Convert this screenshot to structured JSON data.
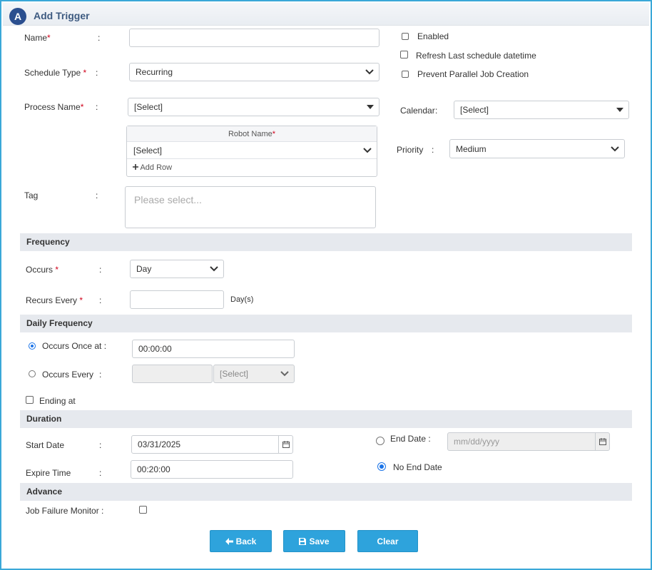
{
  "header": {
    "logo_letter": "A",
    "title": "Add Trigger"
  },
  "form": {
    "name": {
      "label": "Name",
      "value": ""
    },
    "schedule_type": {
      "label": "Schedule Type",
      "value": "Recurring"
    },
    "process_name": {
      "label": "Process Name",
      "value": "[Select]"
    },
    "robot": {
      "header": "Robot Name",
      "value": "[Select]",
      "add_row": "Add Row"
    },
    "tag": {
      "label": "Tag",
      "placeholder": "Please select..."
    },
    "options": {
      "enabled": "Enabled",
      "refresh": "Refresh Last schedule datetime",
      "prevent_parallel": "Prevent Parallel Job Creation"
    },
    "calendar": {
      "label": "Calendar",
      "value": "[Select]"
    },
    "priority": {
      "label": "Priority",
      "value": "Medium"
    },
    "colon": ":",
    "required_mark": "*"
  },
  "frequency": {
    "heading": "Frequency",
    "occurs": {
      "label": "Occurs",
      "value": "Day"
    },
    "recurs_every": {
      "label": "Recurs Every",
      "value": "",
      "unit": "Day(s)"
    }
  },
  "daily_frequency": {
    "heading": "Daily Frequency",
    "once": {
      "label": "Occurs Once at :",
      "value": "00:00:00"
    },
    "every": {
      "label": "Occurs Every",
      "value": "",
      "unit": "[Select]"
    },
    "ending_at": "Ending at"
  },
  "duration": {
    "heading": "Duration",
    "start_date": {
      "label": "Start Date",
      "value": "03/31/2025"
    },
    "expire_time": {
      "label": "Expire Time",
      "value": "00:20:00"
    },
    "end_date": {
      "label": "End Date :",
      "placeholder": "mm/dd/yyyy"
    },
    "no_end_date": "No End Date"
  },
  "advance": {
    "heading": "Advance",
    "job_failure_monitor": {
      "label": "Job Failure Monitor :"
    }
  },
  "buttons": {
    "back": "Back",
    "save": "Save",
    "clear": "Clear"
  },
  "colors": {
    "accent": "#2ea3dc",
    "frame": "#3aa8d8",
    "section_bg": "#e6e9ee",
    "required": "#d0021b"
  }
}
